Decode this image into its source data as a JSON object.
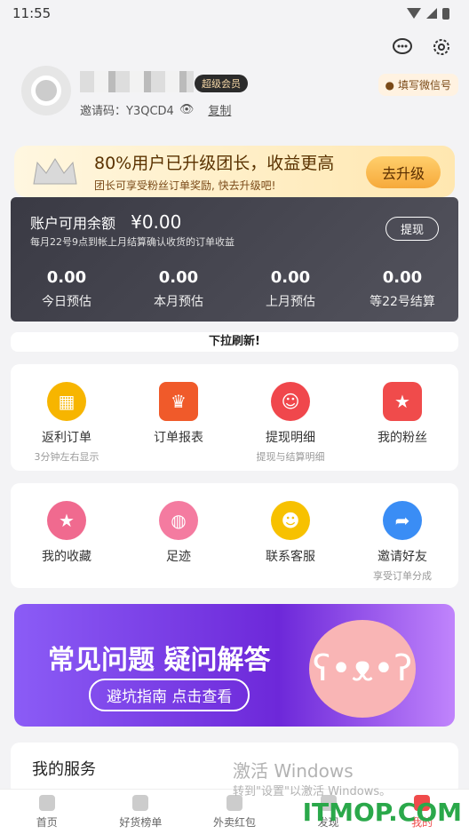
{
  "status": {
    "time": "11:55"
  },
  "header": {
    "icons": [
      "chat-icon",
      "gear-icon"
    ]
  },
  "profile": {
    "badge": "超级会员",
    "invite_code_label": "邀请码：Y3QCD4",
    "copy": "复制",
    "wechat_btn": "填写微信号"
  },
  "promo": {
    "title": "80%用户已升级团长，收益更高",
    "subtitle": "团长可享受粉丝订单奖励, 快去升级吧!",
    "button": "去升级"
  },
  "balance": {
    "title": "账户可用余额",
    "value": "¥0.00",
    "subtitle": "每月22号9点到帐上月结算确认收货的订单收益",
    "withdraw": "提现",
    "stats": [
      {
        "num": "0.00",
        "label": "今日预估"
      },
      {
        "num": "0.00",
        "label": "本月预估"
      },
      {
        "num": "0.00",
        "label": "上月预估"
      },
      {
        "num": "0.00",
        "label": "等22号结算"
      }
    ]
  },
  "pull_tip": "下拉刷新!",
  "grid_row1": [
    {
      "label": "返利订单",
      "sub": "3分钟左右显示",
      "color": "#f7b500",
      "icon": "shop-icon"
    },
    {
      "label": "订单报表",
      "sub": "",
      "color": "#f05a2a",
      "icon": "crown-icon"
    },
    {
      "label": "提现明细",
      "sub": "提现与结算明细",
      "color": "#f0474c",
      "icon": "smile-icon"
    },
    {
      "label": "我的粉丝",
      "sub": "",
      "color": "#f04b4b",
      "icon": "user-star-icon"
    }
  ],
  "grid_row2": [
    {
      "label": "我的收藏",
      "sub": "",
      "color": "#f06a8f",
      "icon": "star-icon"
    },
    {
      "label": "足迹",
      "sub": "",
      "color": "#f47ba0",
      "icon": "footprint-icon"
    },
    {
      "label": "联系客服",
      "sub": "",
      "color": "#f7c100",
      "icon": "emoji-icon"
    },
    {
      "label": "邀请好友",
      "sub": "享受订单分成",
      "color": "#3a8df5",
      "icon": "share-icon"
    }
  ],
  "faq": {
    "title": "常见问题 疑问解答",
    "button": "避坑指南 点击查看"
  },
  "services": {
    "title": "我的服务"
  },
  "watermark": {
    "line1": "激活 Windows",
    "line2": "转到\"设置\"以激活 Windows。",
    "site": "ITMOP.COM"
  },
  "tabs": [
    "首页",
    "好货榜单",
    "外卖红包",
    "发现",
    "我的"
  ]
}
